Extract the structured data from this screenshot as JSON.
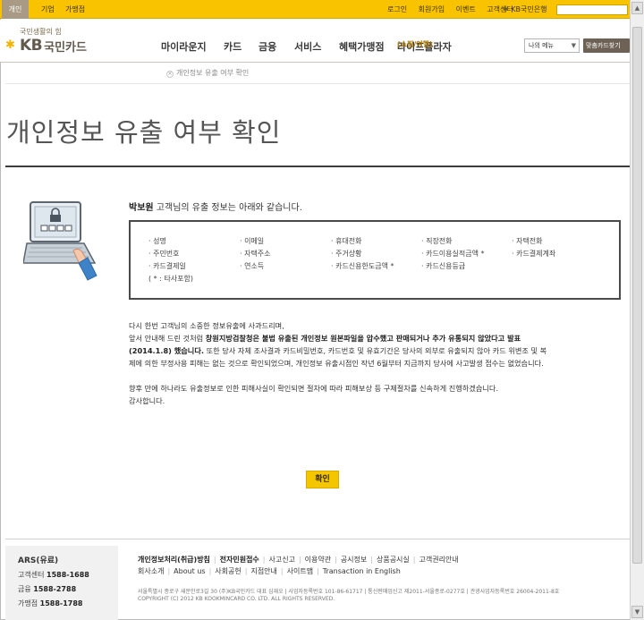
{
  "topbar": {
    "segments": [
      "개인",
      "기업",
      "가맹점"
    ],
    "links": [
      "로그인",
      "회원가입",
      "이벤트",
      "고객센터"
    ],
    "bank_link": "KB국민은행"
  },
  "header": {
    "slogan": "국민생활의 힘",
    "logo_kb": "KB",
    "logo_card": "국민카드",
    "nav": [
      "마이라운지",
      "카드",
      "금융",
      "서비스",
      "혜택가맹점",
      "라이프플라자"
    ],
    "nav_sub": "(쇼핑/여행)",
    "my_menu": "나의 메뉴",
    "card_find": "맞춤카드찾기"
  },
  "breadcrumb": {
    "current": "개인정보 유출 여부 확인"
  },
  "page_title": "개인정보 유출 여부 확인",
  "result": {
    "customer_name": "박보원",
    "greeting_rest": " 고객님의 유출 정보는 아래와 같습니다.",
    "items": [
      "· 성명",
      "· 이메일",
      "· 휴대전화",
      "· 직장전화",
      "· 자택전화",
      "· 주민번호",
      "· 자택주소",
      "· 주거상황",
      "· 카드이용실적금액 *",
      "· 카드결제계좌",
      "· 카드결제일",
      "· 연소득",
      "· 카드신용한도금액 *",
      "· 카드신용등급"
    ],
    "note": "( * : 타사포함)"
  },
  "message": {
    "l1": "다시 한번 고객님의 소중한 정보유출에 사과드리며,",
    "l2a": "앞서 안내해 드린 것처럼 ",
    "l2b": "창원지방검찰청은 불법 유출된 개인정보 원본파일을 압수했고 판매되거나 추가 유통되지 않았다고 발표",
    "l3a": "(2014.1.8) 했습니다.",
    "l3b": " 또한 당사 자체 조사결과 카드비밀번호, 카드번호 및 유효기간은 당사의 외부로 유출되지 않아 카드 위변조 및 복",
    "l4": "제에 의한 부정사용 피해는 없는 것으로 확인되었으며, 개인정보 유출시점인 작년 6월부터 지금까지 당사에 사고발생 접수는 없었습니다.",
    "l5": "향후 만에 하나라도 유출정보로 인한 피해사실이 확인되면 절차에 따라 피해보상 등 구제절차를 신속하게 진행하겠습니다.",
    "l6": "감사합니다."
  },
  "confirm_label": "확인",
  "footer": {
    "ars_title": "ARS(유료)",
    "ars": [
      {
        "label": "고객센터",
        "number": "1588-1688"
      },
      {
        "label": "금융",
        "number": "1588-2788"
      },
      {
        "label": "가맹점",
        "number": "1588-1788"
      }
    ],
    "links_row1": [
      "개인정보처리(취급)방침",
      "전자민원접수",
      "사고신고",
      "이용약관",
      "공시정보",
      "상품공시실",
      "고객권리안내"
    ],
    "links_row2": [
      "회사소개",
      "About us",
      "사회공헌",
      "지점안내",
      "사이트맵",
      "Transaction in English"
    ],
    "address": "서울특별시 종로구 새문안로3길 30 (주)KB국민카드 대표 심재오  |  사업자등록번호 101-86-61717  |  통신판매업신고 제2011-서울종로-0277호  |  관광사업자등록번호 26004-2011-8호",
    "copyright": "COPYRIGHT (C) 2012 KB KOOKMINCARD CO. LTD. ALL RIGHTS RESERVED."
  },
  "colors": {
    "brand_yellow": "#f9c300",
    "brand_gray": "#6d6255",
    "title_rule": "#3b3b3b"
  }
}
